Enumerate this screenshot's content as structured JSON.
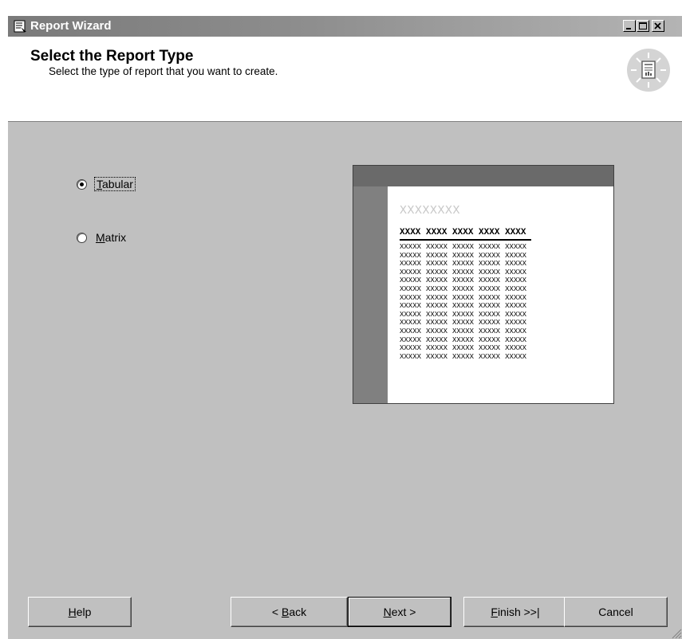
{
  "window": {
    "title": "Report Wizard",
    "icon": "report-wizard-icon",
    "controls": {
      "minimize": "minimize-icon",
      "maximize": "maximize-icon",
      "close": "close-icon"
    }
  },
  "header": {
    "title": "Select the Report Type",
    "subtitle": "Select the type of report that you want to create.",
    "icon": "report-lightbulb-icon"
  },
  "options": {
    "tabular": {
      "pre": "",
      "accel": "T",
      "post": "abular",
      "selected": true
    },
    "matrix": {
      "pre": "",
      "accel": "M",
      "post": "atrix",
      "selected": false
    }
  },
  "preview": {
    "title": "XXXXXXXX",
    "headers": [
      "XXXX",
      "XXXX",
      "XXXX",
      "XXXX",
      "XXXX"
    ],
    "cell": "XXXXX",
    "row_count": 14
  },
  "buttons": {
    "help": {
      "pre": "",
      "accel": "H",
      "post": "elp"
    },
    "back": {
      "pre": "< ",
      "accel": "B",
      "post": "ack"
    },
    "next": {
      "pre": "",
      "accel": "N",
      "post": "ext >"
    },
    "finish": {
      "pre": "",
      "accel": "F",
      "post": "inish >>|"
    },
    "cancel": {
      "label": "Cancel"
    }
  },
  "colors": {
    "dialog_bg": "#c0c0c0",
    "header_bg": "#ffffff",
    "titlebar_start": "#7a7a7a",
    "titlebar_end": "#b4b4b4"
  }
}
